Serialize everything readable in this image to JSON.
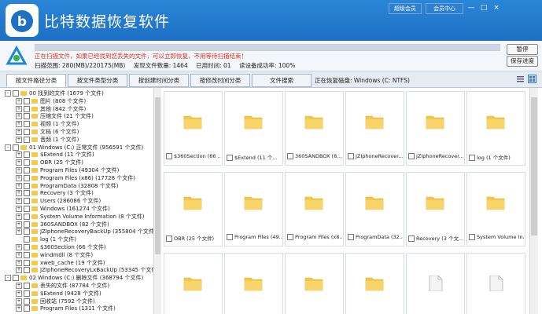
{
  "app": {
    "title": "比特数据恢复软件"
  },
  "titlebar": {
    "vip_label": "超级会员",
    "member_center_label": "会员中心",
    "min_glyph": "—",
    "max_glyph": "□",
    "close_glyph": "×"
  },
  "scan": {
    "message": "正在扫描文件，如果已经找到您丢失的文件，可以立即恢复，不用等待扫描结束！",
    "progress": 1.0,
    "stats": [
      "扫描范围: 280(MB)/220175(MB)",
      "发现文件数量: 1464",
      "已用时间: 01",
      "读设备成功率: 100%"
    ],
    "pause_label": "暂停",
    "save_label": "保存进度"
  },
  "tabs": {
    "items": [
      "按文件路径分类",
      "按文件类型分类",
      "按创建时间分类",
      "按修改时间分类",
      "文件搜索"
    ],
    "current_disk": "正在恢复磁盘: Windows (C: NTFS)"
  },
  "tree": [
    {
      "level": 0,
      "exp": "-",
      "text": "00 找到的文件  (1679 个文件)"
    },
    {
      "level": 1,
      "exp": "+",
      "text": "图片    (808 个文件)"
    },
    {
      "level": 1,
      "exp": "+",
      "text": "其他    (842 个文件)"
    },
    {
      "level": 1,
      "exp": "+",
      "text": "压缩文件    (21 个文件)"
    },
    {
      "level": 1,
      "exp": "+",
      "text": "视频    (1 个文件)"
    },
    {
      "level": 1,
      "exp": "+",
      "text": "文档    (6 个文件)"
    },
    {
      "level": 1,
      "exp": "+",
      "text": "音频    (1 个文件)"
    },
    {
      "level": 0,
      "exp": "-",
      "text": "01 Windows (C:) 正常文件  (956591 个文件)"
    },
    {
      "level": 1,
      "exp": "+",
      "text": "$Extend    (11 个文件)"
    },
    {
      "level": 1,
      "exp": "+",
      "text": "OBR    (25 个文件)"
    },
    {
      "level": 1,
      "exp": "+",
      "text": "Program Files    (49304 个文件)"
    },
    {
      "level": 1,
      "exp": "+",
      "text": "Program Files (x86)    (17728 个文件)"
    },
    {
      "level": 1,
      "exp": "+",
      "text": "ProgramData    (32808 个文件)"
    },
    {
      "level": 1,
      "exp": "+",
      "text": "Recovery    (3 个文件)"
    },
    {
      "level": 1,
      "exp": "+",
      "text": "Users    (286086 个文件)"
    },
    {
      "level": 1,
      "exp": "+",
      "text": "Windows    (161274 个文件)"
    },
    {
      "level": 1,
      "exp": "+",
      "text": "System Volume Information    (8 个文件)"
    },
    {
      "level": 1,
      "exp": "+",
      "text": "360SANDBOX    (82 个文件)"
    },
    {
      "level": 1,
      "exp": "+",
      "text": "JZIphoneRecoveryBackUp    (355804 个文件)"
    },
    {
      "level": 1,
      "exp": "",
      "text": "log    (1 个文件)"
    },
    {
      "level": 1,
      "exp": "+",
      "text": "$360Section    (66 个文件)"
    },
    {
      "level": 1,
      "exp": "+",
      "text": "windmdll    (8 个文件)"
    },
    {
      "level": 1,
      "exp": "+",
      "text": "xweb_cache    (19 个文件)"
    },
    {
      "level": 1,
      "exp": "+",
      "text": "JZIphoneRecoveryLxBackUp    (53345 个文件)"
    },
    {
      "level": 0,
      "exp": "-",
      "text": "02 Windows (C:) 删除文件  (368794 个文件)"
    },
    {
      "level": 1,
      "exp": "+",
      "text": "丢失的文件    (87784 个文件)"
    },
    {
      "level": 1,
      "exp": "+",
      "text": "$Extend    (9428 个文件)"
    },
    {
      "level": 1,
      "exp": "+",
      "text": "回收站    (7592 个文件)"
    },
    {
      "level": 1,
      "exp": "+",
      "text": "Program Files    (1311 个文件)"
    }
  ],
  "grid": [
    {
      "label": "$360Section  (66 ...",
      "icon": "folder"
    },
    {
      "label": "$Extend  (11 个...",
      "icon": "folder"
    },
    {
      "label": "360SANDBOX  (8...",
      "icon": "folder"
    },
    {
      "label": "JZIphoneRecover...",
      "icon": "folder"
    },
    {
      "label": "JZIphoneRecover...",
      "icon": "folder"
    },
    {
      "label": "log  (1 个文件)",
      "icon": "folder"
    },
    {
      "label": "OBR  (25 个文件)",
      "icon": "folder"
    },
    {
      "label": "Program Files  (49...",
      "icon": "folder"
    },
    {
      "label": "Program Files (x8...",
      "icon": "folder"
    },
    {
      "label": "ProgramData  (32...",
      "icon": "folder"
    },
    {
      "label": "Recovery  (3 个文...",
      "icon": "folder"
    },
    {
      "label": "System Volume In...",
      "icon": "folder"
    },
    {
      "label": "",
      "icon": "folder"
    },
    {
      "label": "",
      "icon": "folder"
    },
    {
      "label": "",
      "icon": "folder"
    },
    {
      "label": "",
      "icon": "folder"
    },
    {
      "label": "",
      "icon": "file"
    },
    {
      "label": "",
      "icon": "file"
    }
  ],
  "colors": {
    "accent": "#1d6fc4",
    "warning": "#e0301e",
    "folder": "#f2c94c"
  }
}
